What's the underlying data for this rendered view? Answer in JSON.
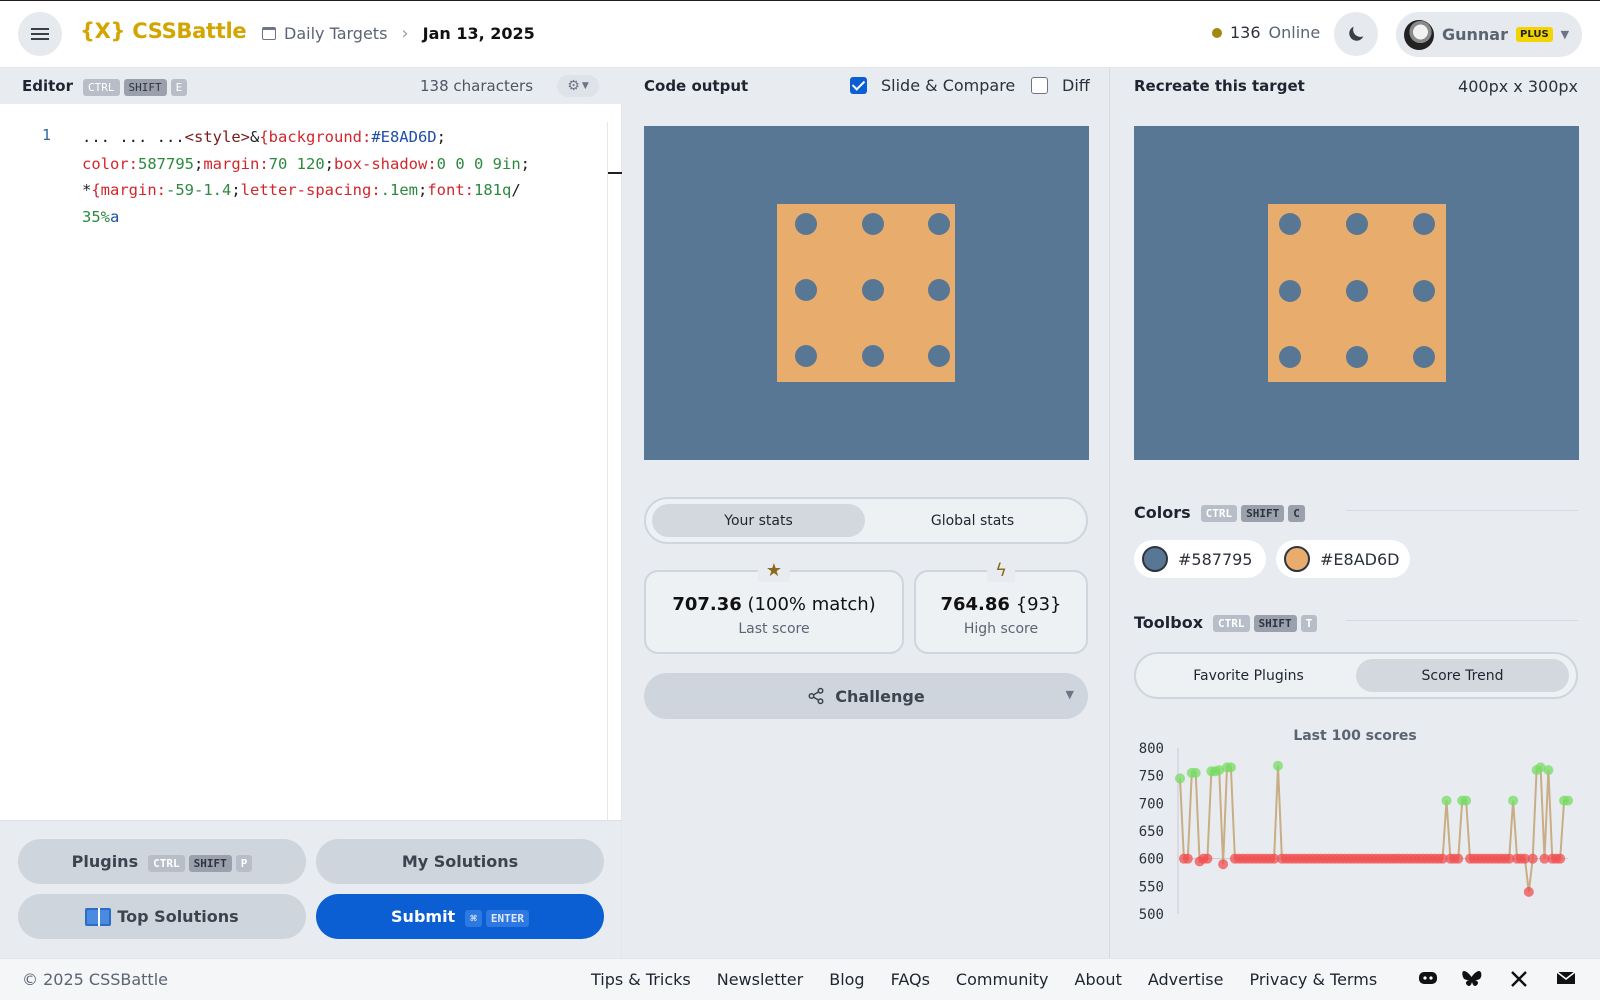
{
  "header": {
    "logo": "{X} CSSBattle",
    "breadcrumb": {
      "section": "Daily Targets",
      "date": "Jan 13, 2025"
    },
    "online_count": "136",
    "online_label": "Online",
    "user": {
      "name": "Gunnar",
      "badge": "PLUS"
    }
  },
  "editor": {
    "title": "Editor",
    "shortcut": [
      "CTRL",
      "SHIFT",
      "E"
    ],
    "char_count": "138 characters",
    "line_number": "1",
    "code_tokens": [
      {
        "t": "... ... ...",
        "c": "sel"
      },
      {
        "t": "<style>",
        "c": "tag"
      },
      {
        "t": "&",
        "c": "sel"
      },
      {
        "t": "{background:",
        "c": "prop"
      },
      {
        "t": "#E8AD6D",
        "c": "hex"
      },
      {
        "t": ";\n",
        "c": "sel"
      },
      {
        "t": "color:",
        "c": "prop"
      },
      {
        "t": "587795",
        "c": "val"
      },
      {
        "t": ";",
        "c": "sel"
      },
      {
        "t": "margin:",
        "c": "prop"
      },
      {
        "t": "70 120",
        "c": "val"
      },
      {
        "t": ";",
        "c": "sel"
      },
      {
        "t": "box-shadow:",
        "c": "prop"
      },
      {
        "t": "0 0 0 9in",
        "c": "val"
      },
      {
        "t": ";\n",
        "c": "sel"
      },
      {
        "t": "*",
        "c": "sel"
      },
      {
        "t": "{margin:",
        "c": "prop"
      },
      {
        "t": "-59-1.4",
        "c": "val"
      },
      {
        "t": ";",
        "c": "sel"
      },
      {
        "t": "letter-spacing:",
        "c": "prop"
      },
      {
        "t": ".1em",
        "c": "val"
      },
      {
        "t": ";",
        "c": "sel"
      },
      {
        "t": "font:",
        "c": "prop"
      },
      {
        "t": "181q",
        "c": "val"
      },
      {
        "t": "/\n",
        "c": "sel"
      },
      {
        "t": "35%",
        "c": "val"
      },
      {
        "t": "a",
        "c": "hex"
      }
    ],
    "buttons": {
      "plugins": "Plugins",
      "plugins_shortcut": [
        "CTRL",
        "SHIFT",
        "P"
      ],
      "my_solutions": "My Solutions",
      "top_solutions": "Top Solutions",
      "submit": "Submit",
      "submit_shortcut": [
        "⌘",
        "ENTER"
      ]
    }
  },
  "output": {
    "title": "Code output",
    "slide_compare_label": "Slide & Compare",
    "slide_compare_checked": true,
    "diff_label": "Diff",
    "diff_checked": false,
    "stats_tabs": [
      "Your stats",
      "Global stats"
    ],
    "active_stats_tab": "Your stats",
    "last_score": {
      "value": "707.36",
      "detail": "(100% match)",
      "label": "Last score"
    },
    "high_score": {
      "value": "764.86",
      "detail": "{93}",
      "label": "High score"
    },
    "challenge_label": "Challenge"
  },
  "target": {
    "title": "Recreate this target",
    "dimensions": "400px x 300px",
    "colors_title": "Colors",
    "colors_shortcut": [
      "CTRL",
      "SHIFT",
      "C"
    ],
    "colors": [
      {
        "hex": "#587795",
        "label": "#587795"
      },
      {
        "hex": "#E8AD6D",
        "label": "#E8AD6D"
      }
    ],
    "toolbox_title": "Toolbox",
    "toolbox_shortcut": [
      "CTRL",
      "SHIFT",
      "T"
    ],
    "toolbox_tabs": [
      "Favorite Plugins",
      "Score Trend"
    ],
    "active_toolbox_tab": "Score Trend"
  },
  "colors": {
    "bg": "#587795",
    "fg": "#E8AD6D",
    "accent": "#0b5fd3",
    "brand": "#d3a500"
  },
  "chart_data": {
    "type": "line",
    "title": "Last 100 scores",
    "ylim": [
      500,
      800
    ],
    "yticks": [
      "800",
      "750",
      "700",
      "650",
      "600",
      "550",
      "500"
    ],
    "values": [
      745,
      600,
      600,
      755,
      755,
      595,
      600,
      600,
      758,
      758,
      760,
      590,
      765,
      765,
      600,
      600,
      600,
      600,
      600,
      600,
      600,
      600,
      600,
      600,
      600,
      768,
      600,
      600,
      600,
      600,
      600,
      600,
      600,
      600,
      600,
      600,
      600,
      600,
      600,
      600,
      600,
      600,
      600,
      600,
      600,
      600,
      600,
      600,
      600,
      600,
      600,
      600,
      600,
      600,
      600,
      600,
      600,
      600,
      600,
      600,
      600,
      600,
      600,
      600,
      600,
      600,
      600,
      600,
      705,
      600,
      600,
      600,
      705,
      705,
      600,
      600,
      600,
      600,
      600,
      600,
      600,
      600,
      600,
      600,
      600,
      705,
      600,
      600,
      600,
      540,
      600,
      760,
      765,
      600,
      760,
      600,
      600,
      600,
      705,
      705
    ]
  },
  "footer": {
    "copyright": "© 2025 CSSBattle",
    "links": [
      "Tips & Tricks",
      "Newsletter",
      "Blog",
      "FAQs",
      "Community",
      "About",
      "Advertise",
      "Privacy & Terms"
    ],
    "social_icons": [
      "discord-icon",
      "bluesky-icon",
      "x-icon",
      "mail-icon"
    ]
  }
}
